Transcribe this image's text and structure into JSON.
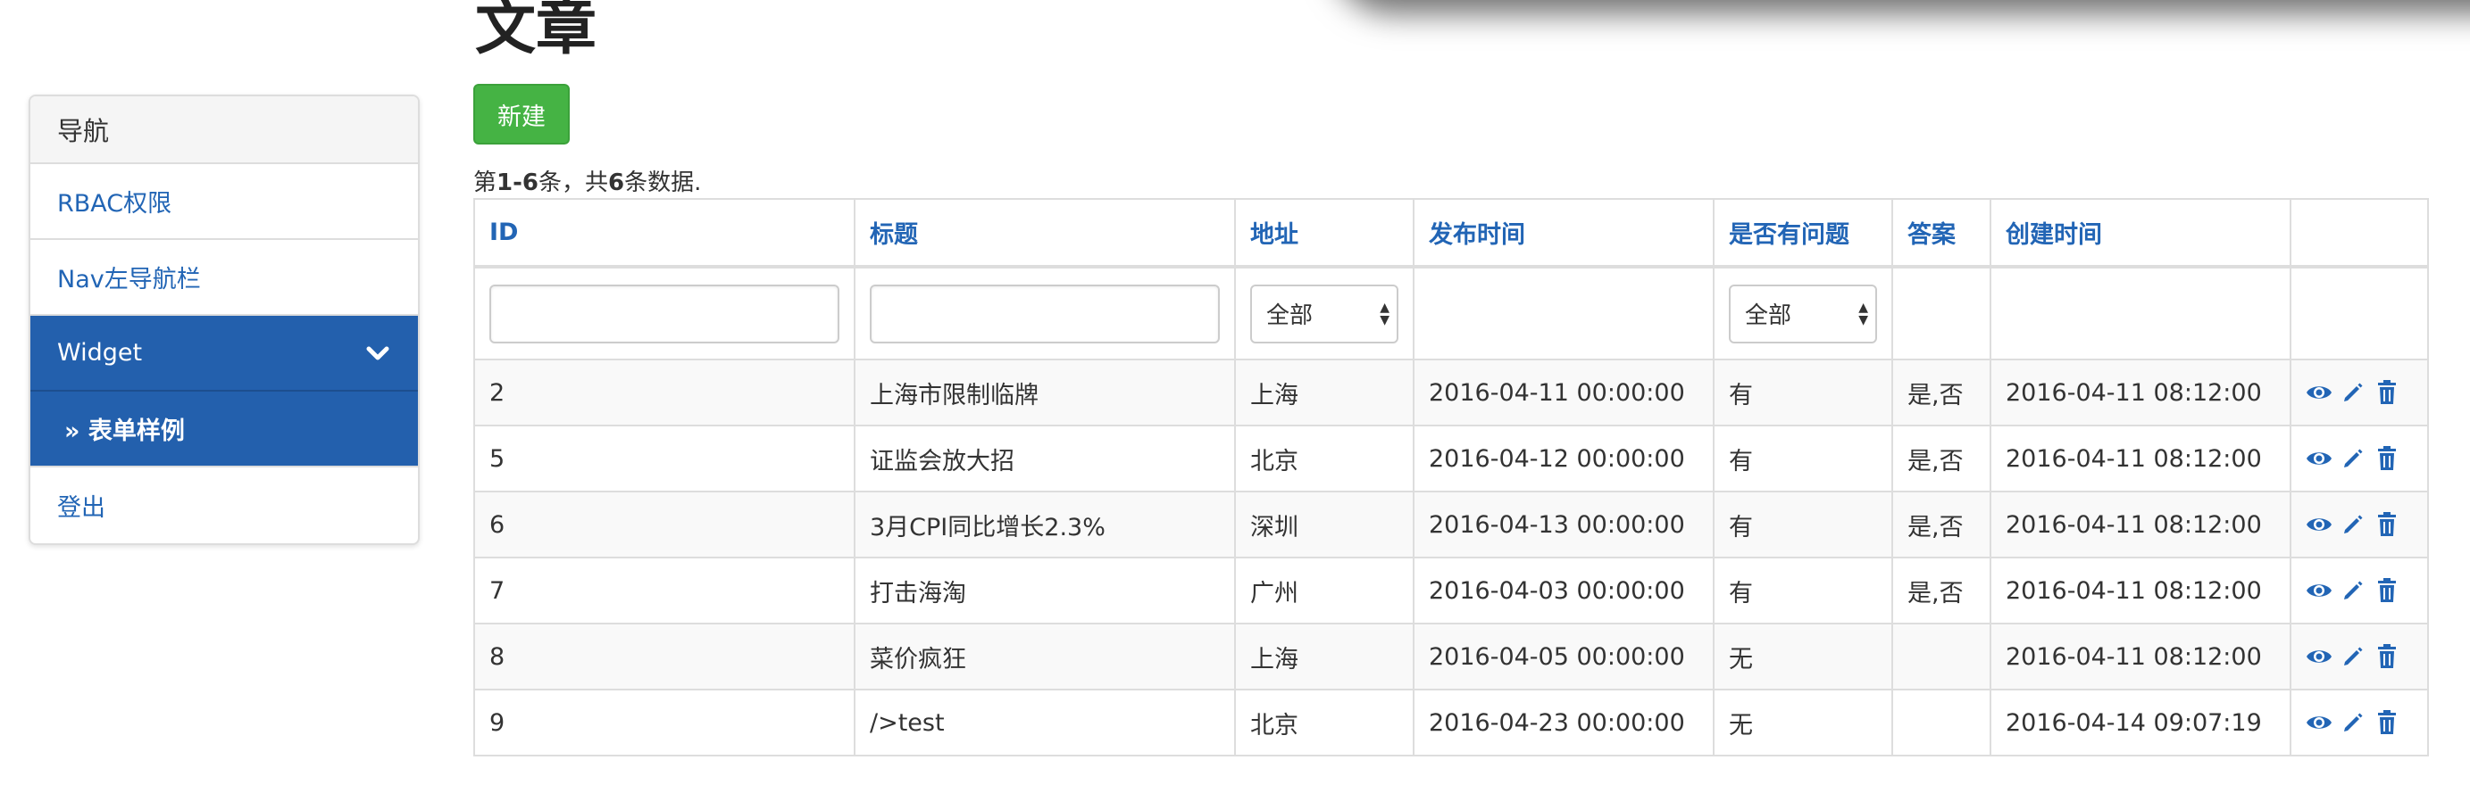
{
  "page": {
    "title": "文章"
  },
  "toolbar": {
    "new_label": "新建"
  },
  "summary": {
    "prefix": "第",
    "range": "1-6",
    "mid": "条，共",
    "total": "6",
    "suffix": "条数据."
  },
  "sidebar": {
    "heading": "导航",
    "items": [
      {
        "label": "RBAC权限"
      },
      {
        "label": "Nav左导航栏"
      },
      {
        "label": "Widget"
      },
      {
        "label": "» 表单样例"
      },
      {
        "label": "登出"
      }
    ]
  },
  "table": {
    "headers": [
      "ID",
      "标题",
      "地址",
      "发布时间",
      "是否有问题",
      "答案",
      "创建时间"
    ],
    "filters": {
      "address_select": "全部",
      "problem_select": "全部"
    },
    "rows": [
      {
        "id": "2",
        "title": "上海市限制临牌",
        "address": "上海",
        "published": "2016-04-11 00:00:00",
        "problem": "有",
        "answer": "是,否",
        "created": "2016-04-11 08:12:00"
      },
      {
        "id": "5",
        "title": "证监会放大招",
        "address": "北京",
        "published": "2016-04-12 00:00:00",
        "problem": "有",
        "answer": "是,否",
        "created": "2016-04-11 08:12:00"
      },
      {
        "id": "6",
        "title": "3月CPI同比增长2.3%",
        "address": "深圳",
        "published": "2016-04-13 00:00:00",
        "problem": "有",
        "answer": "是,否",
        "created": "2016-04-11 08:12:00"
      },
      {
        "id": "7",
        "title": "打击海淘",
        "address": "广州",
        "published": "2016-04-03 00:00:00",
        "problem": "有",
        "answer": "是,否",
        "created": "2016-04-11 08:12:00"
      },
      {
        "id": "8",
        "title": "菜价疯狂",
        "address": "上海",
        "published": "2016-04-05 00:00:00",
        "problem": "无",
        "answer": "",
        "created": "2016-04-11 08:12:00"
      },
      {
        "id": "9",
        "title": "/>test",
        "address": "北京",
        "published": "2016-04-23 00:00:00",
        "problem": "无",
        "answer": "",
        "created": "2016-04-14 09:07:19"
      }
    ]
  },
  "icons": {
    "view": "eye-icon",
    "edit": "pencil-icon",
    "delete": "trash-icon"
  },
  "colors": {
    "link": "#2265b5",
    "sidebar_active": "#2360ad",
    "new_button": "#45b344"
  }
}
